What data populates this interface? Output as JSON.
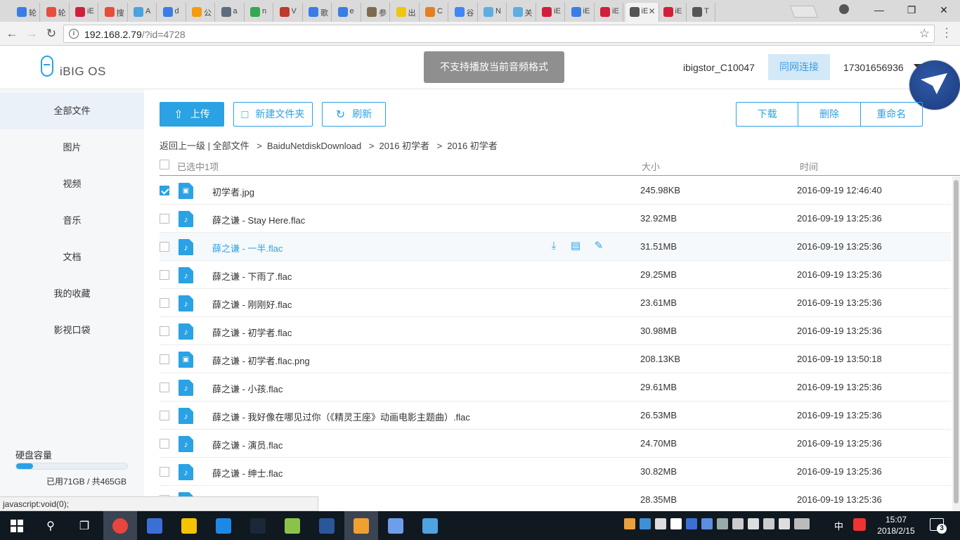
{
  "browser": {
    "tabs": [
      {
        "text": "轮",
        "color": "#3b7de6"
      },
      {
        "text": "轮",
        "color": "#e84c3d"
      },
      {
        "text": "iE",
        "color": "#d11f3a"
      },
      {
        "text": "搜",
        "color": "#e74c3c"
      },
      {
        "text": "A",
        "color": "#4aa3df"
      },
      {
        "text": "d",
        "color": "#3b7de6"
      },
      {
        "text": "公",
        "color": "#f39c12"
      },
      {
        "text": "a",
        "color": "#5d6d7e"
      },
      {
        "text": "n",
        "color": "#34a853"
      },
      {
        "text": "V",
        "color": "#c0392b"
      },
      {
        "text": "歌",
        "color": "#3b7de6"
      },
      {
        "text": "e",
        "color": "#3b7de6"
      },
      {
        "text": "参",
        "color": "#7f6a50"
      },
      {
        "text": "出",
        "color": "#f1c40f"
      },
      {
        "text": "C",
        "color": "#e67e22"
      },
      {
        "text": "谷",
        "color": "#4285f4"
      },
      {
        "text": "N",
        "color": "#5dade2"
      },
      {
        "text": "关",
        "color": "#5dade2"
      },
      {
        "text": "iE",
        "color": "#d11f3a"
      },
      {
        "text": "iE",
        "color": "#3b7de6"
      },
      {
        "text": "iE",
        "color": "#d11f3a"
      },
      {
        "text": "iE",
        "color": "#555555",
        "active": true
      },
      {
        "text": "iE",
        "color": "#d11f3a"
      },
      {
        "text": "T",
        "color": "#555555"
      }
    ],
    "url_host": "192.168.2.79",
    "url_rest": "/?id=4728",
    "status_text": "javascript:void(0);"
  },
  "app": {
    "logo": "iBIG OS",
    "toast": "不支持播放当前音频格式",
    "device": "ibigstor_C10047",
    "lan_button": "同网连接",
    "account": "17301656936"
  },
  "sidebar": {
    "items": [
      {
        "label": "全部文件",
        "active": true
      },
      {
        "label": "图片"
      },
      {
        "label": "视频"
      },
      {
        "label": "音乐"
      },
      {
        "label": "文档"
      },
      {
        "label": "我的收藏"
      },
      {
        "label": "影视口袋"
      }
    ],
    "disk_label": "硬盘容量",
    "disk_usage": "已用71GB / 共465GB",
    "disk_used_fraction": 0.153
  },
  "toolbar": {
    "upload": "上传",
    "new_folder": "新建文件夹",
    "refresh": "刷新",
    "download": "下载",
    "delete": "删除",
    "rename": "重命名"
  },
  "breadcrumb": {
    "back": "返回上一级",
    "root": "全部文件",
    "path": [
      "BaiduNetdiskDownload",
      "2016 初学者",
      "2016 初学者"
    ]
  },
  "list": {
    "selected_text": "已选中1项",
    "col_size": "大小",
    "col_time": "时间",
    "files": [
      {
        "name": "初学者.jpg",
        "type": "image",
        "size": "245.98KB",
        "time": "2016-09-19 12:46:40",
        "checked": true
      },
      {
        "name": "薛之谦 - Stay Here.flac",
        "type": "audio",
        "size": "32.92MB",
        "time": "2016-09-19 13:25:36"
      },
      {
        "name": "薛之谦 - 一半.flac",
        "type": "audio",
        "size": "31.51MB",
        "time": "2016-09-19 13:25:36",
        "hover": true
      },
      {
        "name": "薛之谦 - 下雨了.flac",
        "type": "audio",
        "size": "29.25MB",
        "time": "2016-09-19 13:25:36"
      },
      {
        "name": "薛之谦 - 刚刚好.flac",
        "type": "audio",
        "size": "23.61MB",
        "time": "2016-09-19 13:25:36"
      },
      {
        "name": "薛之谦 - 初学者.flac",
        "type": "audio",
        "size": "30.98MB",
        "time": "2016-09-19 13:25:36"
      },
      {
        "name": "薛之谦 - 初学者.flac.png",
        "type": "image",
        "size": "208.13KB",
        "time": "2016-09-19 13:50:18"
      },
      {
        "name": "薛之谦 - 小孩.flac",
        "type": "audio",
        "size": "29.61MB",
        "time": "2016-09-19 13:25:36"
      },
      {
        "name": "薛之谦 - 我好像在哪见过你（《精灵王座》动画电影主题曲）.flac",
        "type": "audio",
        "size": "26.53MB",
        "time": "2016-09-19 13:25:36"
      },
      {
        "name": "薛之谦 - 演员.flac",
        "type": "audio",
        "size": "24.70MB",
        "time": "2016-09-19 13:25:36"
      },
      {
        "name": "薛之谦 - 绅士.flac",
        "type": "audio",
        "size": "30.82MB",
        "time": "2016-09-19 13:25:36"
      },
      {
        "name": "",
        "type": "audio",
        "size": "28.35MB",
        "time": "2016-09-19 13:25:36"
      }
    ]
  },
  "taskbar": {
    "apps": [
      {
        "name": "chrome",
        "color": "#e8453c",
        "active": true
      },
      {
        "name": "feiq",
        "color": "#3b6fd6"
      },
      {
        "name": "explorer",
        "color": "#f5c400"
      },
      {
        "name": "app-blue",
        "color": "#1e88e5"
      },
      {
        "name": "steam",
        "color": "#1b2838"
      },
      {
        "name": "flower",
        "color": "#8bc34a"
      },
      {
        "name": "word",
        "color": "#2b579a"
      },
      {
        "name": "qq",
        "color": "#f0a030",
        "active": true
      },
      {
        "name": "photos",
        "color": "#6d9eeb"
      },
      {
        "name": "control",
        "color": "#4fa3e0"
      }
    ],
    "ime": "中",
    "time": "15:07",
    "date": "2018/2/15",
    "notifications": "3"
  }
}
